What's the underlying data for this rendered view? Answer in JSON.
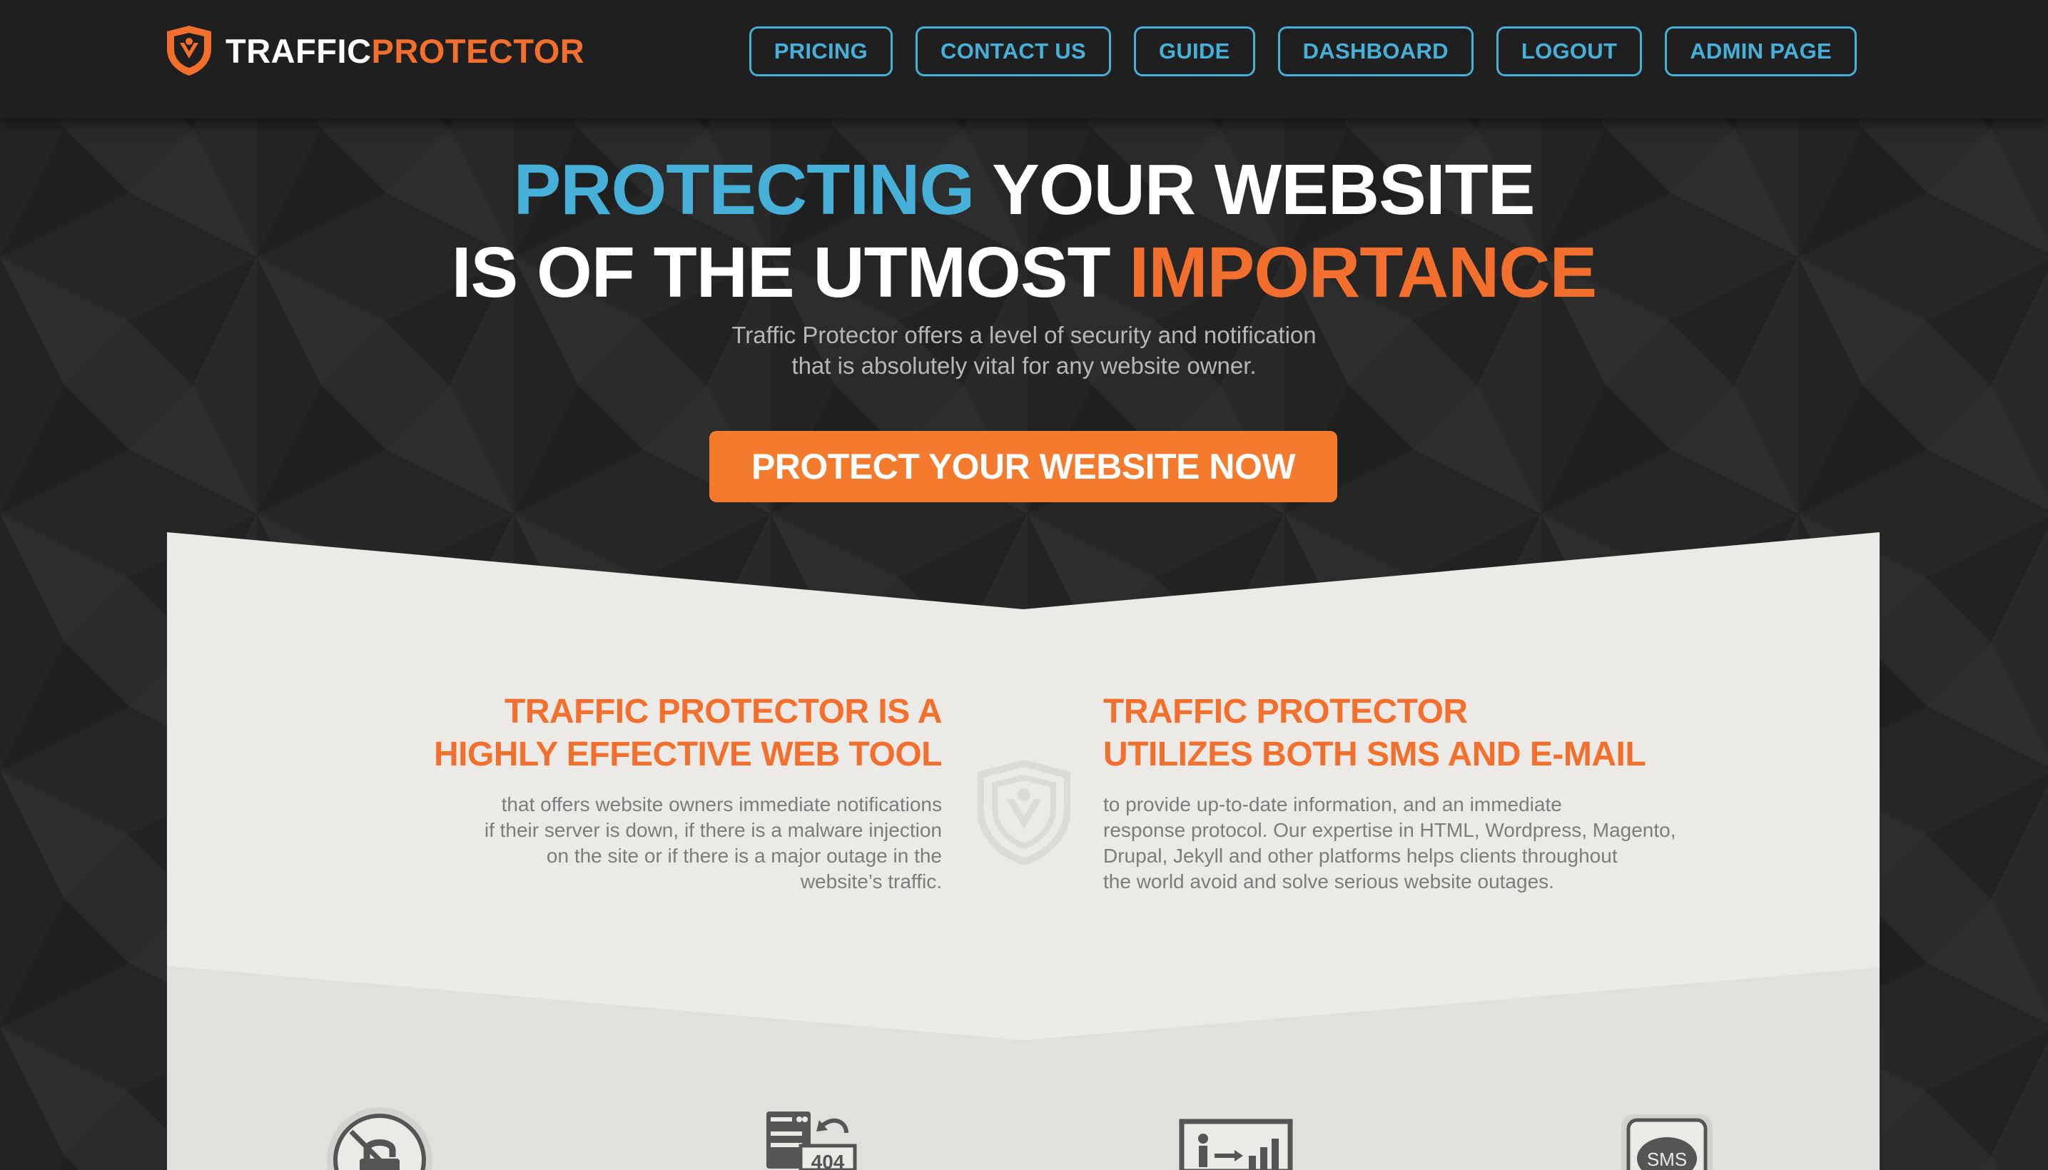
{
  "brand": {
    "name_part1": "TRAFFIC",
    "name_part2": "PROTECTOR"
  },
  "colors": {
    "accent_orange": "#f26f2d",
    "accent_blue": "#46b0d8",
    "header_bg": "#1f1f1f",
    "panel_bg": "#ebeae6"
  },
  "nav": {
    "items": [
      {
        "label": "PRICING"
      },
      {
        "label": "CONTACT US"
      },
      {
        "label": "GUIDE"
      },
      {
        "label": "DASHBOARD"
      },
      {
        "label": "LOGOUT"
      },
      {
        "label": "ADMIN PAGE"
      }
    ]
  },
  "hero": {
    "line1_highlight": "PROTECTING",
    "line1_rest": " YOUR WEBSITE",
    "line2_rest": "IS OF THE UTMOST ",
    "line2_highlight": "IMPORTANCE",
    "sub_line1": "Traffic Protector offers a level of security and notification",
    "sub_line2": "that is absolutely vital for any website owner.",
    "cta_label": "PROTECT YOUR WEBSITE NOW"
  },
  "features": {
    "left": {
      "title_line1": "TRAFFIC PROTECTOR IS A",
      "title_line2": "HIGHLY EFFECTIVE WEB TOOL",
      "text_line1": "that offers website owners immediate notifications",
      "text_line2": "if their server is down, if there is a malware injection",
      "text_line3": "on the site or if there is a major outage in the",
      "text_line4": "website’s traffic."
    },
    "right": {
      "title_line1": "TRAFFIC PROTECTOR",
      "title_line2": "UTILIZES BOTH SMS AND E-MAIL",
      "text_line1": "to provide up-to-date information, and an immediate",
      "text_line2": "response protocol. Our expertise in HTML, Wordpress, Magento,",
      "text_line3": "Drupal, Jekyll and other platforms helps clients throughout",
      "text_line4": "the world avoid and solve serious website outages."
    }
  },
  "bottom_icons": {
    "items": [
      {
        "icon": "no-malware-lock-icon"
      },
      {
        "icon": "server-404-icon",
        "label": "404"
      },
      {
        "icon": "traffic-chart-icon"
      },
      {
        "icon": "sms-icon",
        "label": "SMS"
      }
    ]
  }
}
